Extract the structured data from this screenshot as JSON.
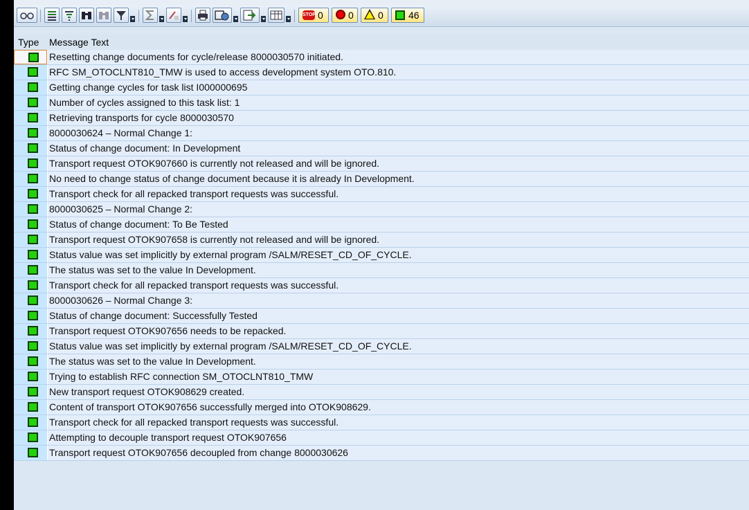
{
  "toolbar": {
    "counters": {
      "stop": "0",
      "error": "0",
      "warning": "0",
      "success": "46"
    }
  },
  "table": {
    "columns": [
      "Type",
      "Message Text"
    ],
    "rows": [
      "Resetting change documents for cycle/release 8000030570 initiated.",
      "RFC SM_OTOCLNT810_TMW is used to access development system OTO.810.",
      "Getting change cycles for task list I000000695",
      "Number of cycles assigned to this task list: 1",
      "Retrieving transports for cycle 8000030570",
      "8000030624 – Normal Change 1:",
      "Status of change document: In Development",
      "Transport request OTOK907660 is currently not released and will be ignored.",
      "No need to change status of change document because it is already In Development.",
      "Transport check for all repacked transport requests was successful.",
      "8000030625 – Normal Change 2:",
      "Status of change document: To Be Tested",
      "Transport request OTOK907658 is currently not released and will be ignored.",
      "Status value was set implicitly by external program /SALM/RESET_CD_OF_CYCLE.",
      "The status was set to the value In Development.",
      "Transport check for all repacked transport requests was successful.",
      "8000030626 – Normal Change 3:",
      "Status of change document: Successfully Tested",
      "Transport request OTOK907656 needs to be repacked.",
      "Status value was set implicitly by external program /SALM/RESET_CD_OF_CYCLE.",
      "The status was set to the value In Development.",
      "Trying to establish RFC connection SM_OTOCLNT810_TMW",
      "New transport request OTOK908629 created.",
      "Content of transport OTOK907656 successfully merged into OTOK908629.",
      "Transport check for all repacked transport requests was successful.",
      "Attempting to decouple transport request OTOK907656",
      "Transport request OTOK907656 decoupled from change 8000030626"
    ]
  },
  "colors": {
    "success": "#24d10d",
    "row_bg": "#e4eefa",
    "type_cell_bg": "#c7e6ff"
  }
}
